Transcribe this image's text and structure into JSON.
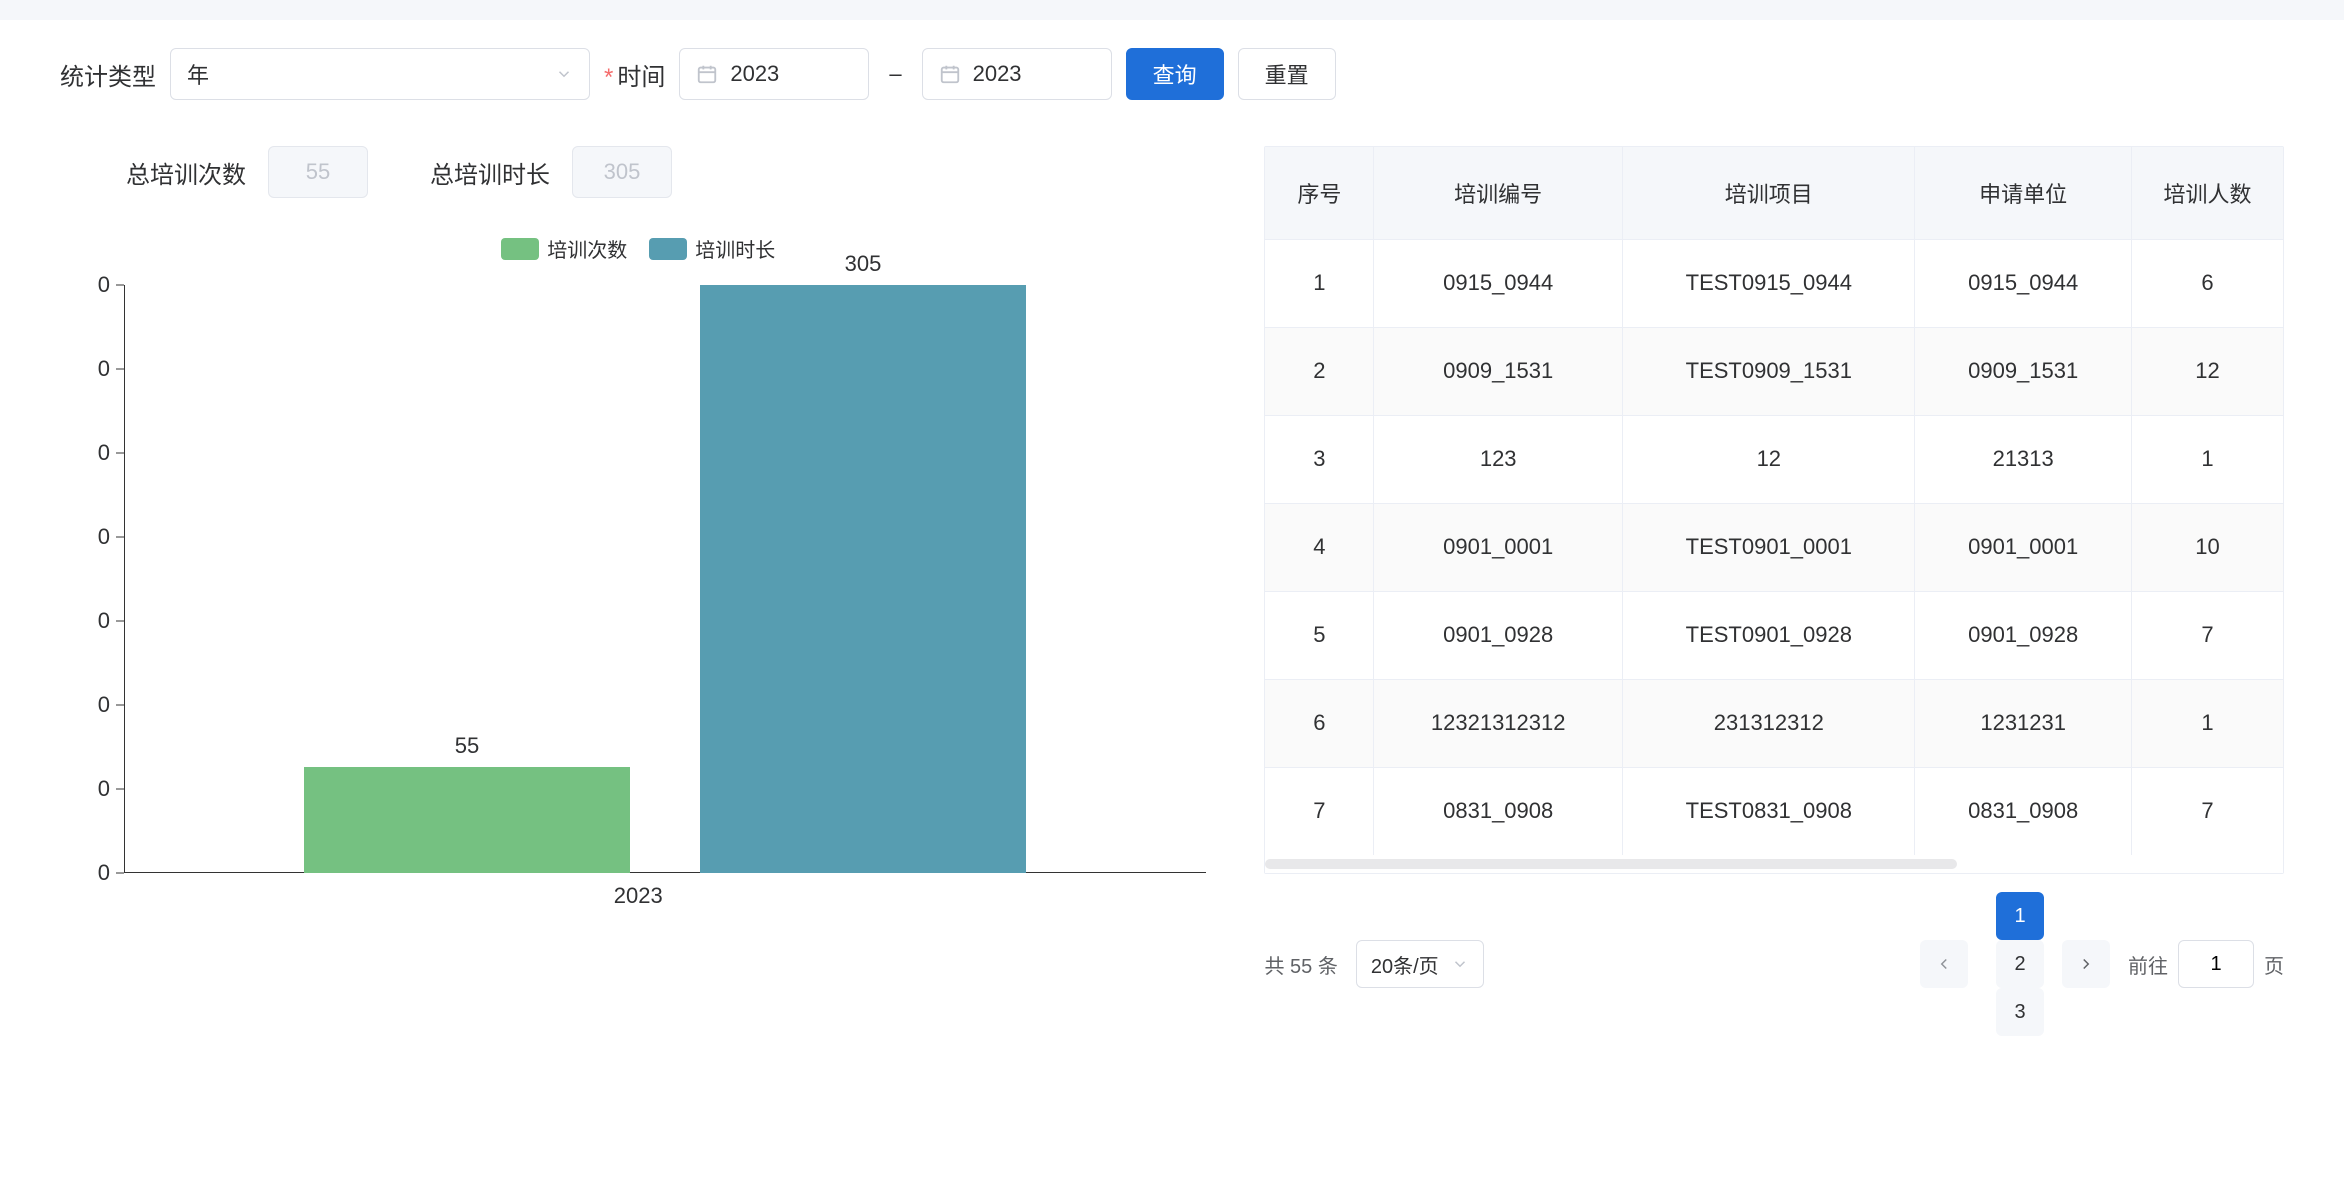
{
  "filters": {
    "type_label": "统计类型",
    "type_value": "年",
    "time_label": "时间",
    "date_from": "2023",
    "date_to": "2023",
    "search_btn": "查询",
    "reset_btn": "重置"
  },
  "summary": {
    "count_label": "总培训次数",
    "count_value": "55",
    "duration_label": "总培训时长",
    "duration_value": "305"
  },
  "colors": {
    "series1": "#75c181",
    "series2": "#579db1",
    "primary": "#1f6fd9"
  },
  "legend": {
    "series1": "培训次数",
    "series2": "培训时长"
  },
  "chart_data": {
    "type": "bar",
    "categories": [
      "2023"
    ],
    "series": [
      {
        "name": "培训次数",
        "values": [
          55
        ]
      },
      {
        "name": "培训时长",
        "values": [
          305
        ]
      }
    ],
    "ylabel": "",
    "xlabel": "",
    "ylim": [
      0,
      305
    ],
    "y_ticks": [
      0,
      0,
      0,
      0,
      0,
      0,
      0,
      0
    ]
  },
  "table": {
    "headers": [
      "序号",
      "培训编号",
      "培训项目",
      "申请单位",
      "培训人数"
    ],
    "rows": [
      [
        "1",
        "0915_0944",
        "TEST0915_0944",
        "0915_0944",
        "6"
      ],
      [
        "2",
        "0909_1531",
        "TEST0909_1531",
        "0909_1531",
        "12"
      ],
      [
        "3",
        "123",
        "12",
        "21313",
        "1"
      ],
      [
        "4",
        "0901_0001",
        "TEST0901_0001",
        "0901_0001",
        "10"
      ],
      [
        "5",
        "0901_0928",
        "TEST0901_0928",
        "0901_0928",
        "7"
      ],
      [
        "6",
        "12321312312",
        "231312312",
        "1231231",
        "1"
      ],
      [
        "7",
        "0831_0908",
        "TEST0831_0908",
        "0831_0908",
        "7"
      ]
    ]
  },
  "pagination": {
    "total_text": "共 55 条",
    "page_size_text": "20条/页",
    "pages": [
      "1",
      "2",
      "3"
    ],
    "current": "1",
    "jump_prefix": "前往",
    "jump_value": "1",
    "jump_suffix": "页"
  }
}
